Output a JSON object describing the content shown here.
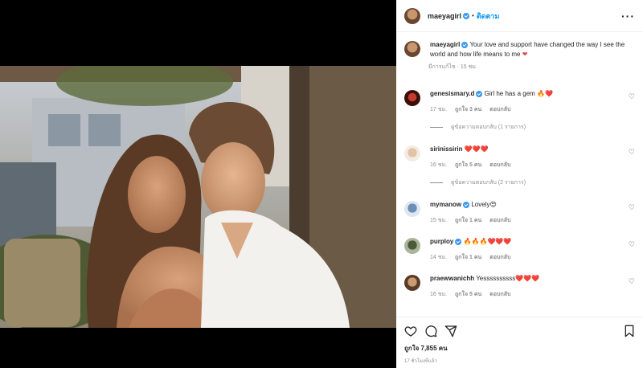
{
  "post": {
    "username": "maeyagirl",
    "follow_label": "ติดตาม",
    "dot": "•",
    "caption_text": "Your love and support have changed the way I see the world and how life means to me",
    "caption_meta": "มีการแก้ไข · 15 ชม."
  },
  "comments": [
    {
      "username": "genesismary.d",
      "text": "Girl he has a gem",
      "emoji": "🔥❤️",
      "time": "17 ชม.",
      "likes": "ถูกใจ 3 คน",
      "reply": "ตอบกลับ",
      "replies": "ดูข้อความตอบกลับ (1 รายการ)"
    },
    {
      "username": "sirinissirin",
      "text": "",
      "emoji": "❤️❤️❤️",
      "time": "16 ชม.",
      "likes": "ถูกใจ 5 คน",
      "reply": "ตอบกลับ",
      "replies": "ดูข้อความตอบกลับ (2 รายการ)"
    },
    {
      "username": "mymanow",
      "text": "Lovely",
      "emoji": "😍",
      "time": "15 ชม.",
      "likes": "ถูกใจ 1 คน",
      "reply": "ตอบกลับ",
      "replies": ""
    },
    {
      "username": "purploy",
      "text": "",
      "emoji": "🔥🔥🔥❤️❤️❤️",
      "time": "14 ชม.",
      "likes": "ถูกใจ 1 คน",
      "reply": "ตอบกลับ",
      "replies": ""
    },
    {
      "username": "praewwanichh",
      "text": "Yessssssssss",
      "emoji": "❤️❤️❤️",
      "time": "16 ชม.",
      "likes": "ถูกใจ 5 คน",
      "reply": "ตอบกลับ",
      "replies": ""
    }
  ],
  "footer": {
    "likes": "ถูกใจ 7,855 คน",
    "ago": "17 ชั่วโมงที่แล้ว"
  },
  "icons": {
    "more": "more-icon",
    "heart": "heart-icon",
    "comment": "comment-icon",
    "share": "share-icon",
    "save": "save-icon"
  }
}
